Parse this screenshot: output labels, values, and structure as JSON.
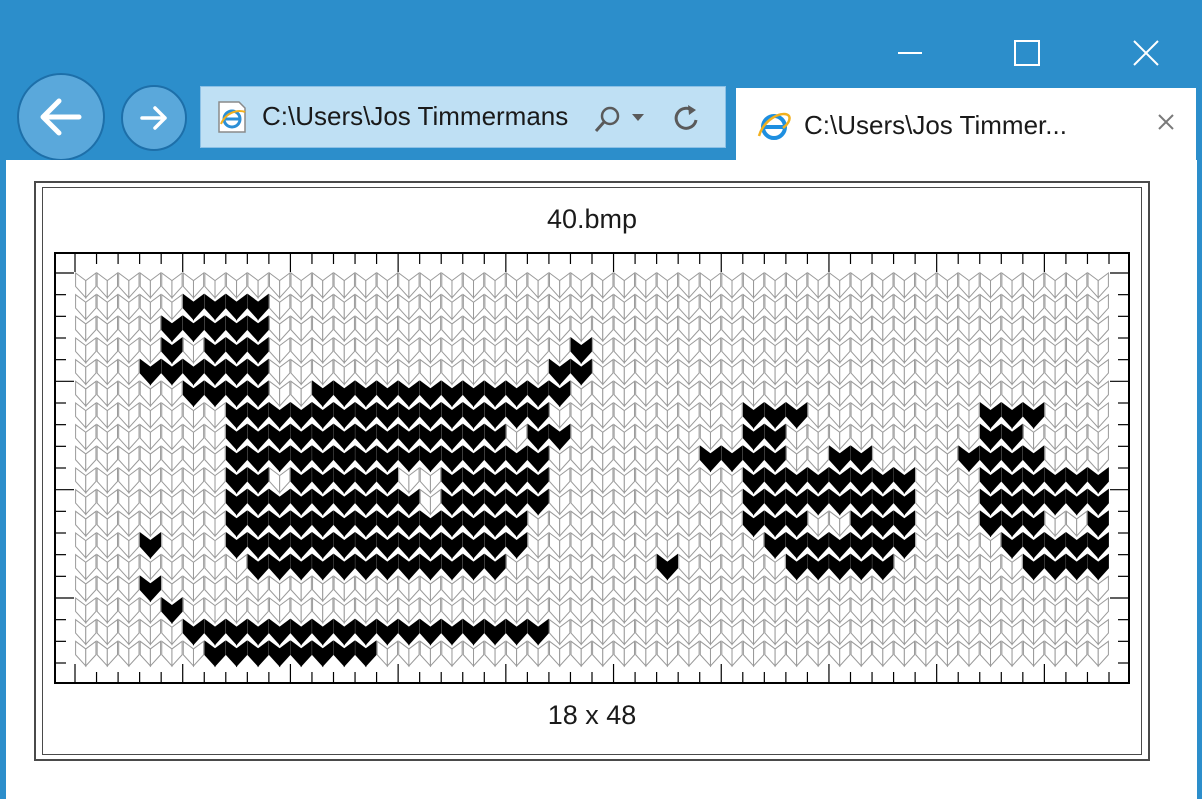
{
  "browser": {
    "address": "C:\\Users\\Jos Timmermans",
    "tab_title": "C:\\Users\\Jos Timmer...",
    "frame_color": "#2c8ecb"
  },
  "document": {
    "image_title": "40.bmp",
    "image_size": "18 x 48"
  },
  "chart_data": {
    "type": "heatmap",
    "rows": 18,
    "cols": 48,
    "legend": "none",
    "grid": true,
    "colors": {
      "filled": "#000000",
      "empty": "#ffffff",
      "stitch_outline": "#9a9a9a"
    },
    "cells": [
      "000000000000000000000000000000000000000000000000",
      "000001111000000000000000000000000000000000000000",
      "000011111000000000000000000000000000000000000000",
      "000010111000000000000001000000000000000000000000",
      "000111111000000000000011000000000000000000000000",
      "000001111001111111111110000000000000000000000000",
      "000000011111111111111100000000011100000000111000",
      "000000011111111111110110000000011000000000110000",
      "000000011111111111111100000001111001100001111000",
      "000000011011111001111100000000011111111000111111",
      "000000011111111101111100000000011111111000111111",
      "000000011111111111111000000000011100111000111001",
      "000100011111111111111000000000001111111000011111",
      "000000001111111111110000000100000111110000001111",
      "000100000000000000000000000000000000000000000000",
      "000010000000000000000000000000000000000000000000",
      "000001111111111111111100000000000000000000000000",
      "000000111111110000000000000000000000000000000000"
    ]
  }
}
